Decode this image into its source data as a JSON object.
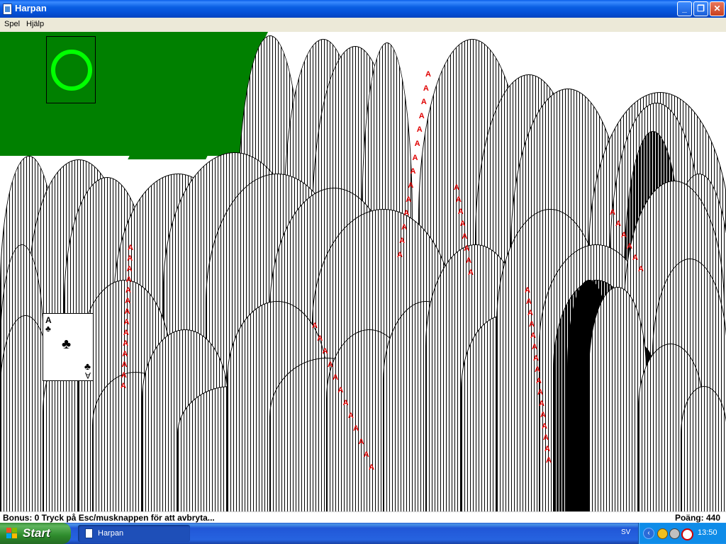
{
  "window": {
    "title": "Harpan",
    "controls": {
      "minimize": "_",
      "maximize": "❐",
      "close": "✕"
    }
  },
  "menu": {
    "items": [
      {
        "label": "Spel"
      },
      {
        "label": "Hjälp"
      }
    ]
  },
  "game": {
    "redeal_indicator": "circle",
    "visible_card": {
      "rank": "A",
      "suit": "♣"
    },
    "suit_marks": {
      "red": "A",
      "black": "A",
      "spade": "♠",
      "club": "♣",
      "two": "2",
      "four": "4",
      "six": "6"
    },
    "colors": {
      "felt": "#008000",
      "redeal_ring": "#00ff00",
      "red_suit": "#e00000"
    }
  },
  "status": {
    "left_text": "Bonus: 0  Tryck på Esc/musknappen för att avbryta...",
    "right_text": "Poäng: 440"
  },
  "taskbar": {
    "start_label": "Start",
    "tasks": [
      {
        "label": "Harpan"
      }
    ],
    "language": "SV",
    "tray_chevron": "‹",
    "clock": "13:50"
  }
}
